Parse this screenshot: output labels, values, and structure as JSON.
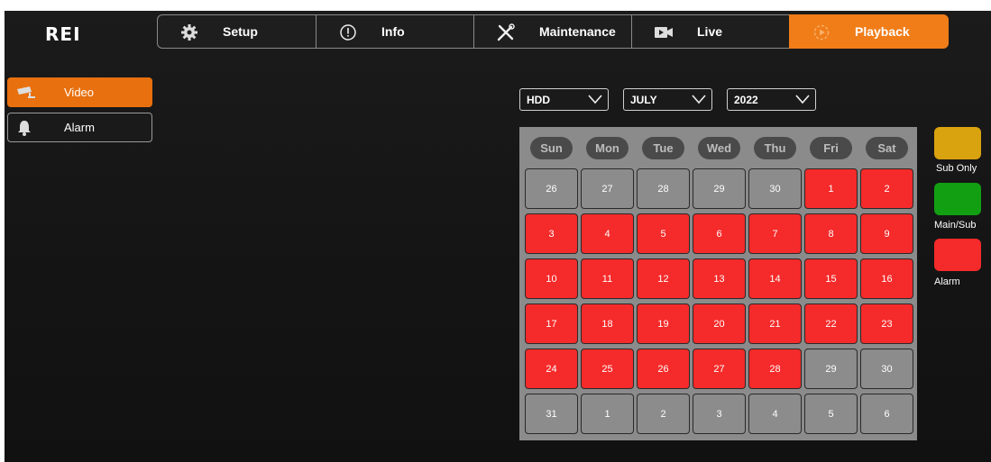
{
  "app": {
    "logo": "REI"
  },
  "nav": {
    "tabs": [
      {
        "label": "Setup",
        "icon": "gear-icon",
        "active": false
      },
      {
        "label": "Info",
        "icon": "info-icon",
        "active": false
      },
      {
        "label": "Maintenance",
        "icon": "tools-icon",
        "active": false
      },
      {
        "label": "Live",
        "icon": "camera-icon",
        "active": false
      },
      {
        "label": "Playback",
        "icon": "playback-icon",
        "active": true
      }
    ]
  },
  "sidebar": {
    "items": [
      {
        "label": "Video",
        "icon": "cctv-camera-icon",
        "active": true
      },
      {
        "label": "Alarm",
        "icon": "bell-icon",
        "active": false
      }
    ]
  },
  "filters": {
    "storage": "HDD",
    "month": "JULY",
    "year": "2022"
  },
  "calendar": {
    "weekdays": [
      "Sun",
      "Mon",
      "Tue",
      "Wed",
      "Thu",
      "Fri",
      "Sat"
    ],
    "weeks": [
      [
        {
          "d": "26",
          "s": "none"
        },
        {
          "d": "27",
          "s": "none"
        },
        {
          "d": "28",
          "s": "none"
        },
        {
          "d": "29",
          "s": "none"
        },
        {
          "d": "30",
          "s": "none"
        },
        {
          "d": "1",
          "s": "alarm"
        },
        {
          "d": "2",
          "s": "alarm"
        }
      ],
      [
        {
          "d": "3",
          "s": "alarm"
        },
        {
          "d": "4",
          "s": "alarm"
        },
        {
          "d": "5",
          "s": "alarm"
        },
        {
          "d": "6",
          "s": "alarm"
        },
        {
          "d": "7",
          "s": "alarm"
        },
        {
          "d": "8",
          "s": "alarm"
        },
        {
          "d": "9",
          "s": "alarm"
        }
      ],
      [
        {
          "d": "10",
          "s": "alarm"
        },
        {
          "d": "11",
          "s": "alarm"
        },
        {
          "d": "12",
          "s": "alarm"
        },
        {
          "d": "13",
          "s": "alarm"
        },
        {
          "d": "14",
          "s": "alarm"
        },
        {
          "d": "15",
          "s": "alarm"
        },
        {
          "d": "16",
          "s": "alarm"
        }
      ],
      [
        {
          "d": "17",
          "s": "alarm"
        },
        {
          "d": "18",
          "s": "alarm"
        },
        {
          "d": "19",
          "s": "alarm"
        },
        {
          "d": "20",
          "s": "alarm"
        },
        {
          "d": "21",
          "s": "alarm"
        },
        {
          "d": "22",
          "s": "alarm"
        },
        {
          "d": "23",
          "s": "alarm"
        }
      ],
      [
        {
          "d": "24",
          "s": "alarm"
        },
        {
          "d": "25",
          "s": "alarm"
        },
        {
          "d": "26",
          "s": "alarm"
        },
        {
          "d": "27",
          "s": "alarm"
        },
        {
          "d": "28",
          "s": "alarm"
        },
        {
          "d": "29",
          "s": "none"
        },
        {
          "d": "30",
          "s": "none"
        }
      ],
      [
        {
          "d": "31",
          "s": "none"
        },
        {
          "d": "1",
          "s": "none"
        },
        {
          "d": "2",
          "s": "none"
        },
        {
          "d": "3",
          "s": "none"
        },
        {
          "d": "4",
          "s": "none"
        },
        {
          "d": "5",
          "s": "none"
        },
        {
          "d": "6",
          "s": "none"
        }
      ]
    ]
  },
  "legend": [
    {
      "label": "Sub Only",
      "color": "#d9a20f"
    },
    {
      "label": "Main/Sub",
      "color": "#12a012"
    },
    {
      "label": "Alarm",
      "color": "#f52a2a"
    }
  ],
  "colors": {
    "accent": "#f07d18",
    "alarm": "#f52a2a",
    "no_record": "#8c8c8c"
  }
}
